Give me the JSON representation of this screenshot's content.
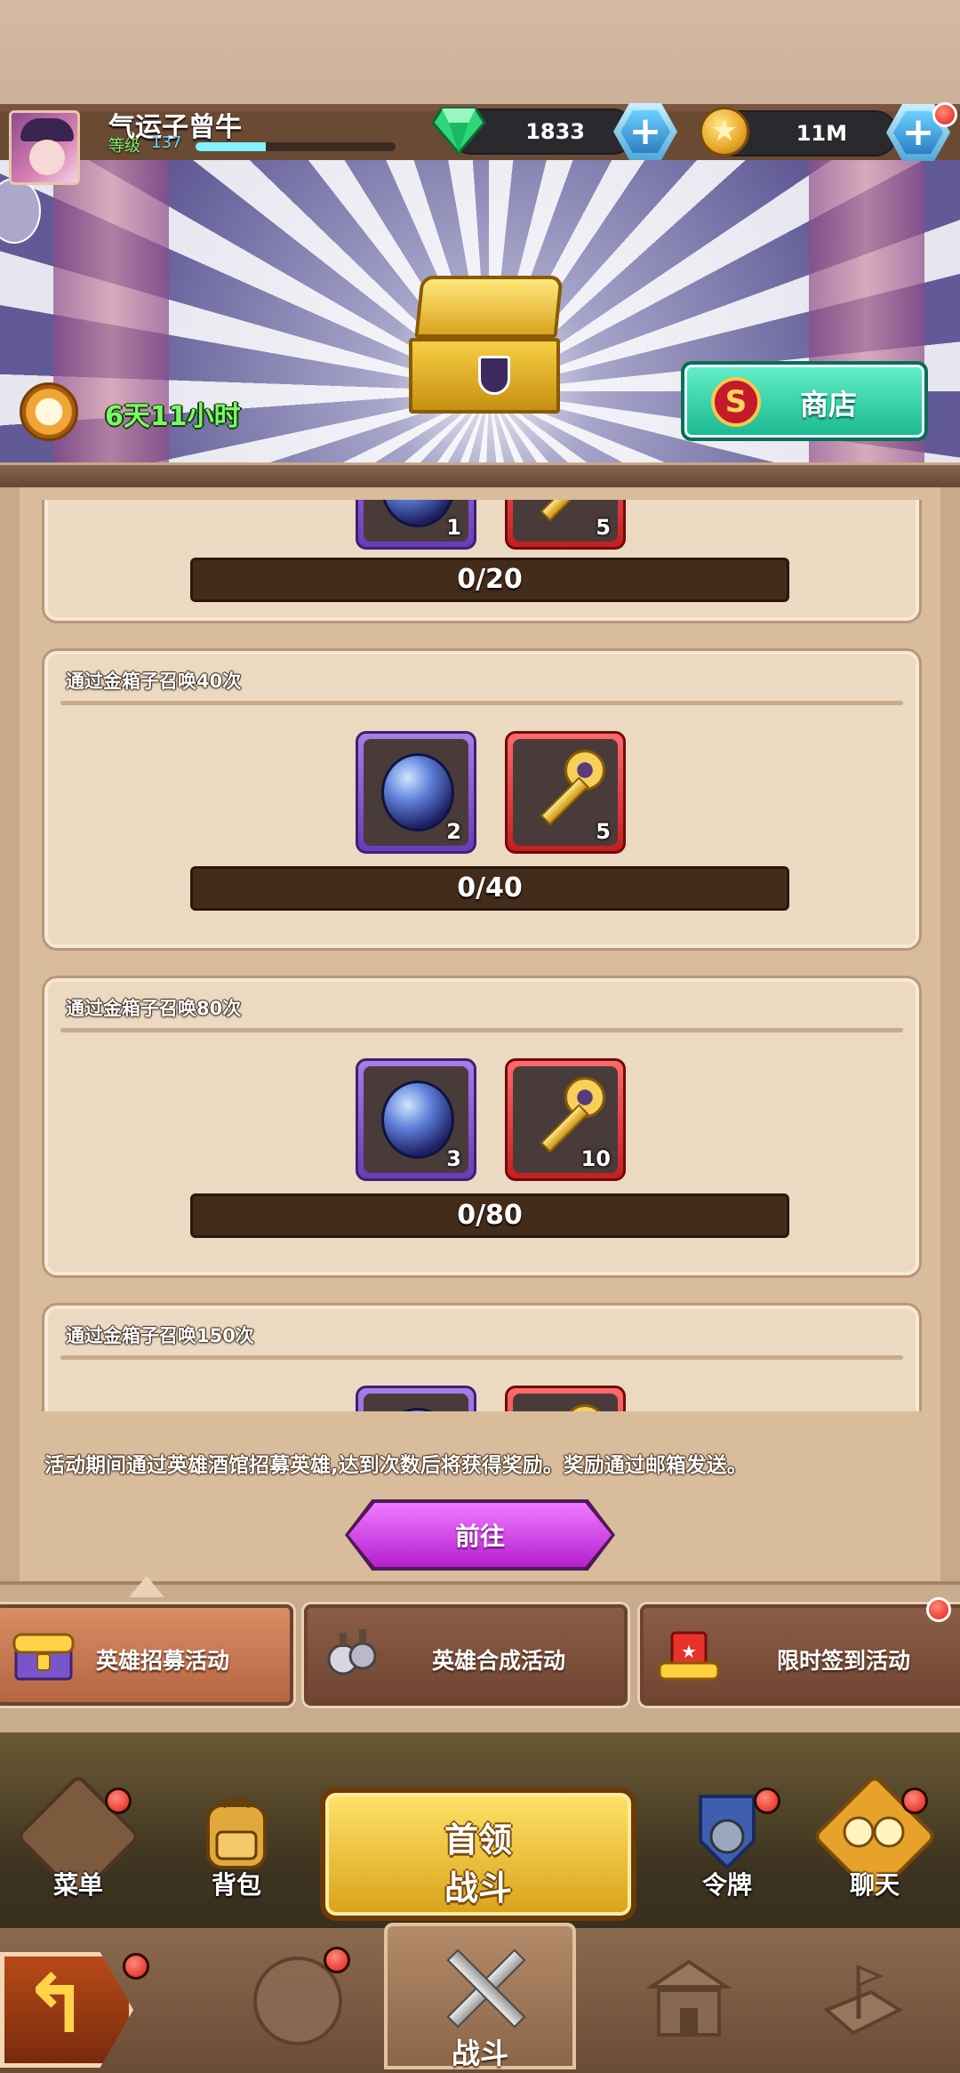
{
  "player": {
    "name": "气运子曾牛",
    "level_label": "等级",
    "level": "137",
    "xp_fraction": 0.35
  },
  "currency": {
    "gems": "1833",
    "coins": "11M"
  },
  "banner": {
    "timer": "6天11小时",
    "shop_label": "商店",
    "shop_icon_letter": "S"
  },
  "tasks": [
    {
      "title": "",
      "rewards": [
        {
          "icon": "moon-orb",
          "qty": "1"
        },
        {
          "icon": "golden-key",
          "qty": "5"
        }
      ],
      "progress": "0/20"
    },
    {
      "title": "通过金箱子召唤40次",
      "rewards": [
        {
          "icon": "moon-orb",
          "qty": "2"
        },
        {
          "icon": "golden-key",
          "qty": "5"
        }
      ],
      "progress": "0/40"
    },
    {
      "title": "通过金箱子召唤80次",
      "rewards": [
        {
          "icon": "moon-orb",
          "qty": "3"
        },
        {
          "icon": "golden-key",
          "qty": "10"
        }
      ],
      "progress": "0/80"
    },
    {
      "title": "通过金箱子召唤150次",
      "rewards": [
        {
          "icon": "moon-orb",
          "qty": ""
        },
        {
          "icon": "golden-key",
          "qty": ""
        }
      ],
      "progress": ""
    }
  ],
  "description": "活动期间通过英雄酒馆招募英雄,达到次数后将获得奖励。奖励通过邮箱发送。",
  "go_label": "前往",
  "activity_tabs": [
    {
      "label": "英雄招募活动",
      "icon": "treasure-chest-icon",
      "active": true
    },
    {
      "label": "英雄合成活动",
      "icon": "hero-fusion-icon",
      "active": false
    },
    {
      "label": "限时签到活动",
      "icon": "gift-box-icon",
      "active": false
    }
  ],
  "menu": {
    "menu": "菜单",
    "bag": "背包",
    "boss_line1": "首领",
    "boss_line2": "战斗",
    "badge": "令牌",
    "chat": "聊天"
  },
  "nav": {
    "battle": "战斗"
  },
  "colors": {
    "shop_button": "#19b88e",
    "go_button": "#b51fcf",
    "timer_text": "#7cf66a",
    "notification": "#e21d15"
  }
}
